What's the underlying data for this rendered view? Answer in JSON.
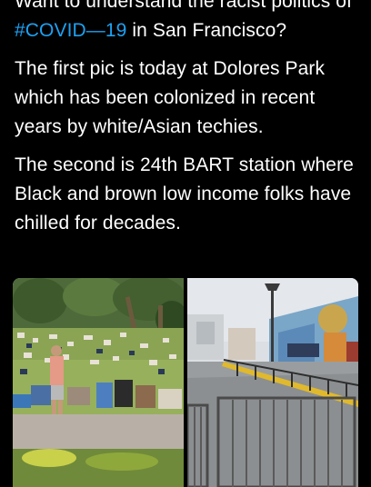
{
  "tweet": {
    "paragraphs": [
      {
        "segments": [
          {
            "text": "Want to understand the racist politics of ",
            "type": "text"
          },
          {
            "text": "#COVID—19",
            "type": "hashtag"
          },
          {
            "text": " in San Francisco?",
            "type": "text"
          }
        ]
      },
      {
        "segments": [
          {
            "text": "The first pic is today at Dolores Park which has been colonized in recent years by white/Asian techies.",
            "type": "text"
          }
        ]
      },
      {
        "segments": [
          {
            "text": "The second is 24th BART station where Black and brown low income folks have chilled for decades.",
            "type": "text"
          }
        ]
      }
    ],
    "hashtag_color": "#1da1f2"
  },
  "media": [
    {
      "name": "dolores-park-photo",
      "description_icon": "park-crowd-image"
    },
    {
      "name": "bart-station-photo",
      "description_icon": "plaza-mural-image"
    }
  ]
}
